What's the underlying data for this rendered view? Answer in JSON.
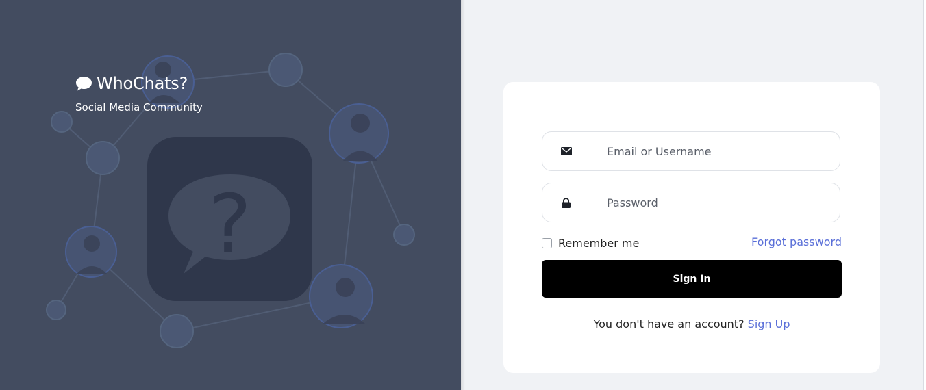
{
  "brand": {
    "title": "WhoChats?",
    "subtitle": "Social Media Community",
    "icon": "speech-bubble-icon"
  },
  "login": {
    "email_placeholder": "Email or Username",
    "email_icon": "envelope-icon",
    "password_placeholder": "Password",
    "password_icon": "lock-icon",
    "remember_label": "Remember me",
    "forgot_label": "Forgot password",
    "signin_label": "Sign In",
    "signup_prompt": "You don't have an account?",
    "signup_label": "Sign Up"
  },
  "colors": {
    "left_panel": "#434c60",
    "background": "#f0f2f5",
    "link": "#5a6fd8",
    "button": "#000000"
  }
}
